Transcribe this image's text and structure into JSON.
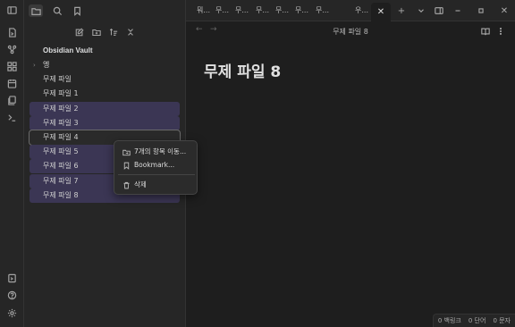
{
  "vault": {
    "name": "Obsidian Vault"
  },
  "files": [
    {
      "label": "옝",
      "kind": "folder",
      "selected": false
    },
    {
      "label": "무제 파일",
      "kind": "file",
      "selected": false
    },
    {
      "label": "무제 파일 1",
      "kind": "file",
      "selected": false
    },
    {
      "label": "무제 파일 2",
      "kind": "file",
      "selected": true
    },
    {
      "label": "무제 파일 3",
      "kind": "file",
      "selected": true
    },
    {
      "label": "무제 파일 4",
      "kind": "file",
      "selected": true,
      "focused": true
    },
    {
      "label": "무제 파일 5",
      "kind": "file",
      "selected": true
    },
    {
      "label": "무제 파일 6",
      "kind": "file",
      "selected": true
    },
    {
      "label": "무제 파일 7",
      "kind": "file",
      "selected": true
    },
    {
      "label": "무제 파일 8",
      "kind": "file",
      "selected": true
    }
  ],
  "tabs": [
    "뭐...",
    "무...",
    "무...",
    "무...",
    "무...",
    "무...",
    "무...",
    "우..."
  ],
  "view": {
    "header_title": "무제 파일 8",
    "doc_title": "무제 파일 8"
  },
  "context_menu": {
    "move": "7개의 항목 이동...",
    "bookmark": "Bookmark...",
    "delete": "삭제"
  },
  "status": {
    "backlinks": "0 백링크",
    "words": "0 단어",
    "chars": "0 문자"
  },
  "colors": {
    "background": "#1e1e1e",
    "sidebar": "#262626",
    "selection": "#3b3654"
  }
}
